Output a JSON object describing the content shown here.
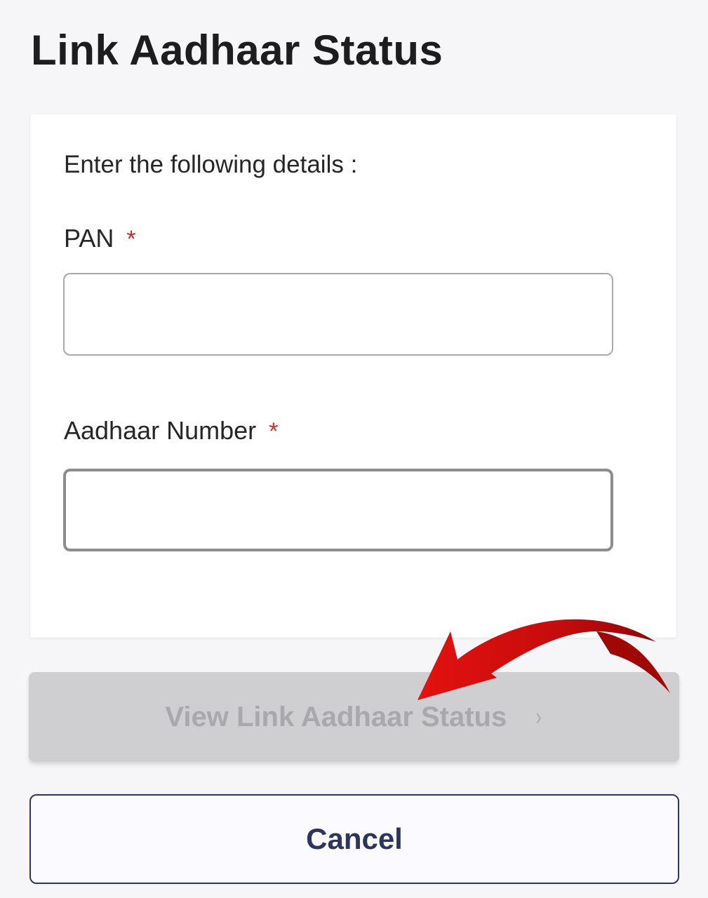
{
  "page": {
    "title": "Link Aadhaar Status"
  },
  "form": {
    "instructions": "Enter the following details :",
    "required_marker": "*",
    "pan": {
      "label": "PAN",
      "value": "",
      "placeholder": ""
    },
    "aadhaar": {
      "label": "Aadhaar Number",
      "value": "",
      "placeholder": ""
    }
  },
  "actions": {
    "submit_label": "View Link Aadhaar Status",
    "submit_chevron": "›",
    "submit_disabled": true,
    "cancel_label": "Cancel"
  },
  "colors": {
    "required_mark": "#c0312c",
    "cancel_accent": "#2c3560",
    "disabled_button_bg": "#cfcfd1",
    "annotation_arrow": "#d10f0f"
  },
  "icons": {
    "submit_chevron": "chevron-right-icon",
    "annotation": "curved-red-arrow-icon"
  }
}
